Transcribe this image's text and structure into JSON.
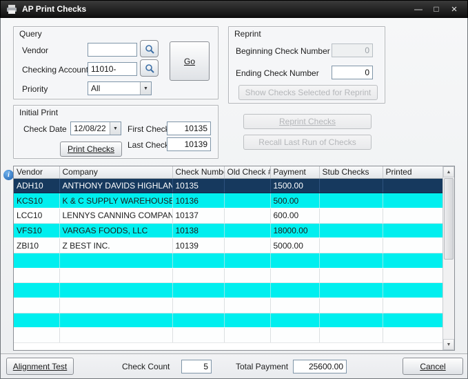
{
  "window": {
    "title": "AP Print Checks",
    "minimize": "—",
    "maximize": "□",
    "close": "×"
  },
  "query": {
    "title": "Query",
    "vendor": {
      "label": "Vendor",
      "value": ""
    },
    "checking_account": {
      "label": "Checking Account",
      "value": "11010-"
    },
    "priority": {
      "label": "Priority",
      "value": "All"
    },
    "go_button": "Go"
  },
  "reprint": {
    "title": "Reprint",
    "beginning_check_number": {
      "label": "Beginning Check Number",
      "value": "0"
    },
    "ending_check_number": {
      "label": "Ending Check Number",
      "value": "0"
    },
    "show_checks_button": "Show Checks Selected for Reprint",
    "reprint_checks_button": "Reprint Checks",
    "recall_button": "Recall Last Run of Checks"
  },
  "initial_print": {
    "title": "Initial Print",
    "check_date": {
      "label": "Check Date",
      "value": "12/08/22"
    },
    "first_check": {
      "label": "First Check",
      "value": "10135"
    },
    "last_check": {
      "label": "Last Check",
      "value": "10139"
    },
    "print_checks_button": "Print Checks"
  },
  "grid": {
    "columns": [
      "Vendor",
      "Company",
      "Check Number",
      "Old Check #",
      "Payment",
      "Stub Checks",
      "Printed"
    ],
    "rows": [
      {
        "vendor": "ADH10",
        "company": "ANTHONY DAVIDS HIGHLAND CO",
        "check_number": "10135",
        "old_check": "",
        "payment": "1500.00",
        "stub_checks": "",
        "printed": "",
        "selected": true
      },
      {
        "vendor": "KCS10",
        "company": "K & C SUPPLY WAREHOUSE",
        "check_number": "10136",
        "old_check": "",
        "payment": "500.00",
        "stub_checks": "",
        "printed": "",
        "selected": false
      },
      {
        "vendor": "LCC10",
        "company": "LENNYS CANNING COMPANY",
        "check_number": "10137",
        "old_check": "",
        "payment": "600.00",
        "stub_checks": "",
        "printed": "",
        "selected": false
      },
      {
        "vendor": "VFS10",
        "company": "VARGAS FOODS, LLC",
        "check_number": "10138",
        "old_check": "",
        "payment": "18000.00",
        "stub_checks": "",
        "printed": "",
        "selected": false
      },
      {
        "vendor": "ZBI10",
        "company": "Z BEST INC.",
        "check_number": "10139",
        "old_check": "",
        "payment": "5000.00",
        "stub_checks": "",
        "printed": "",
        "selected": false
      }
    ],
    "empty_rows": 6
  },
  "footer": {
    "alignment_test_button": "Alignment Test",
    "check_count": {
      "label": "Check Count",
      "value": "5"
    },
    "total_payment": {
      "label": "Total Payment",
      "value": "25600.00"
    },
    "cancel_button": "Cancel"
  },
  "colors": {
    "titlebar": "#141414",
    "row_cyan": "#00efef",
    "row_selected": "#16395e",
    "disabled_text": "#b4b6b9",
    "info_icon_blue": "#1b5fae"
  }
}
